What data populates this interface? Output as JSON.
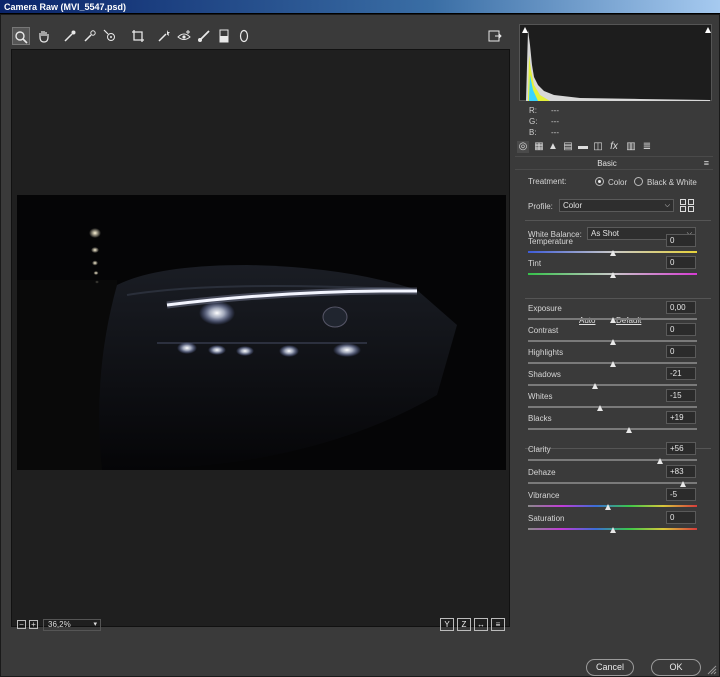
{
  "window": {
    "title": "Camera Raw (MVI_5547.psd)"
  },
  "toolbar": {
    "tools": [
      {
        "name": "zoom-tool",
        "icon": "magnifier-icon",
        "active": true
      },
      {
        "name": "hand-tool",
        "icon": "hand-icon"
      },
      {
        "name": "white-balance-tool",
        "icon": "eyedropper-icon"
      },
      {
        "name": "color-sampler-tool",
        "icon": "color-sampler-icon"
      },
      {
        "name": "targeted-adjustment-tool",
        "icon": "target-adjust-icon"
      },
      {
        "name": "crop-tool",
        "icon": "crop-icon"
      },
      {
        "name": "spot-removal-tool",
        "icon": "spot-removal-icon"
      },
      {
        "name": "red-eye-tool",
        "icon": "red-eye-icon"
      },
      {
        "name": "adjustment-brush-tool",
        "icon": "brush-icon"
      },
      {
        "name": "graduated-filter-tool",
        "icon": "graduated-filter-icon"
      },
      {
        "name": "radial-filter-tool",
        "icon": "radial-filter-icon"
      }
    ],
    "fullscreen_icon": "fullscreen-icon"
  },
  "zoom": {
    "value": "36,2%"
  },
  "view_buttons": [
    "Y",
    "Z",
    "↔",
    "≡"
  ],
  "histogram": {
    "r": "---",
    "g": "---",
    "b": "---",
    "r_label": "R:",
    "g_label": "G:",
    "b_label": "B:"
  },
  "panel": {
    "title": "Basic"
  },
  "treatment": {
    "label": "Treatment:",
    "option_color": "Color",
    "option_bw": "Black & White",
    "selected": "Color"
  },
  "profile": {
    "label": "Profile:",
    "value": "Color"
  },
  "white_balance": {
    "label": "White Balance:",
    "value": "As Shot"
  },
  "links": {
    "auto": "Auto",
    "default": "Default"
  },
  "sliders": [
    {
      "key": "temperature",
      "label": "Temperature",
      "value": "0",
      "pos": 0.5
    },
    {
      "key": "tint",
      "label": "Tint",
      "value": "0",
      "pos": 0.5
    },
    {
      "key": "exposure",
      "label": "Exposure",
      "value": "0,00",
      "pos": 0.5
    },
    {
      "key": "contrast",
      "label": "Contrast",
      "value": "0",
      "pos": 0.5
    },
    {
      "key": "highlights",
      "label": "Highlights",
      "value": "0",
      "pos": 0.5
    },
    {
      "key": "shadows",
      "label": "Shadows",
      "value": "-21",
      "pos": 0.395
    },
    {
      "key": "whites",
      "label": "Whites",
      "value": "-15",
      "pos": 0.425
    },
    {
      "key": "blacks",
      "label": "Blacks",
      "value": "+19",
      "pos": 0.595
    },
    {
      "key": "clarity",
      "label": "Clarity",
      "value": "+56",
      "pos": 0.78
    },
    {
      "key": "dehaze",
      "label": "Dehaze",
      "value": "+83",
      "pos": 0.915
    },
    {
      "key": "vibrance",
      "label": "Vibrance",
      "value": "-5",
      "pos": 0.475
    },
    {
      "key": "saturation",
      "label": "Saturation",
      "value": "0",
      "pos": 0.5
    }
  ],
  "buttons": {
    "cancel": "Cancel",
    "ok": "OK"
  }
}
